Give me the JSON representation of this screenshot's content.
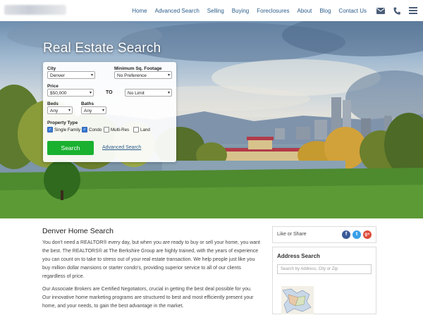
{
  "nav": {
    "links": [
      "Home",
      "Advanced Search",
      "Selling",
      "Buying",
      "Foreclosures",
      "About",
      "Blog",
      "Contact Us"
    ],
    "icons": [
      "envelope-icon",
      "phone-icon",
      "menu-icon"
    ],
    "link_color": "#2b5d8a"
  },
  "hero": {
    "title": "Real Estate Search"
  },
  "search": {
    "city_label": "City",
    "city_value": "Denver",
    "sqft_label": "Minimum Sq. Footage",
    "sqft_value": "No Preference",
    "price_label": "Price",
    "price_min": "$50,000",
    "price_to": "TO",
    "price_max": "No Limit",
    "beds_label": "Beds",
    "beds_value": "Any",
    "baths_label": "Baths",
    "baths_value": "Any",
    "type_label": "Property Type",
    "types": [
      {
        "label": "Single Family",
        "checked": true
      },
      {
        "label": "Condo",
        "checked": true
      },
      {
        "label": "Multi-Res",
        "checked": false
      },
      {
        "label": "Land",
        "checked": false
      }
    ],
    "button": "Search",
    "advanced_link": "Advanced Search",
    "button_color": "#19b12f"
  },
  "content": {
    "heading": "Denver Home Search",
    "p1": "You don't need a REALTOR® every day, but when you are ready to buy or sell your home, you want the best.  The REALTORS® at The Berkshire Group are highly trained, with the years of experience you can count on to take to stress out of your real estate transaction. We help people just like you buy million dollar mansions or starter condo's, providing superior service to all of our clients regardless of price.",
    "p2": "Our Associate Brokers are Certified Negotiators, crucial in getting the best deal possible for you.  Our innovative home marketing programs are structured to best and most efficiently present your home, and your needs, to gain the best advantage in the market."
  },
  "sidebar": {
    "share_label": "Like or Share",
    "social": [
      {
        "name": "facebook-icon",
        "glyph": "f",
        "color": "#3b5998"
      },
      {
        "name": "twitter-icon",
        "glyph": "t",
        "color": "#3aa0e8"
      },
      {
        "name": "google-plus-icon",
        "glyph": "g+",
        "color": "#dd4b39"
      }
    ],
    "address_title": "Address Search",
    "address_placeholder": "Search by Address, City or Zip"
  }
}
